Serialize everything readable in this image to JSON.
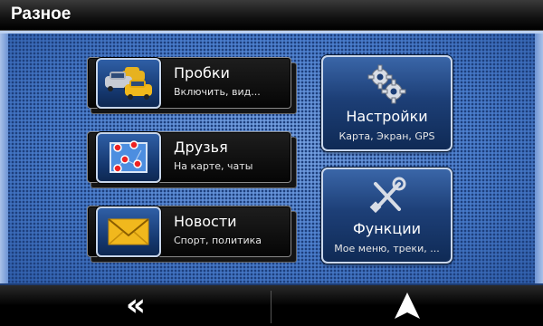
{
  "header": {
    "title": "Разное"
  },
  "menu": {
    "items": [
      {
        "label": "Пробки",
        "sub": "Включить, вид...",
        "icon": "traffic-cars-icon"
      },
      {
        "label": "Друзья",
        "sub": "На карте, чаты",
        "icon": "friends-map-icon"
      },
      {
        "label": "Новости",
        "sub": "Спорт, политика",
        "icon": "envelope-icon"
      }
    ],
    "buttons": [
      {
        "label": "Настройки",
        "sub": "Карта, Экран, GPS",
        "icon": "gears-icon"
      },
      {
        "label": "Функции",
        "sub": "Мое меню, треки, ...",
        "icon": "tools-icon"
      }
    ]
  },
  "footer": {
    "back_glyph": "«",
    "back_icon": "double-chevron-left-icon",
    "nav_icon": "navigation-arrow-icon"
  },
  "colors": {
    "background_blue": "#3f73c4",
    "button_blue": "#1d3f77",
    "card_black": "#0b0b0b",
    "envelope_yellow": "#f1b81d"
  }
}
